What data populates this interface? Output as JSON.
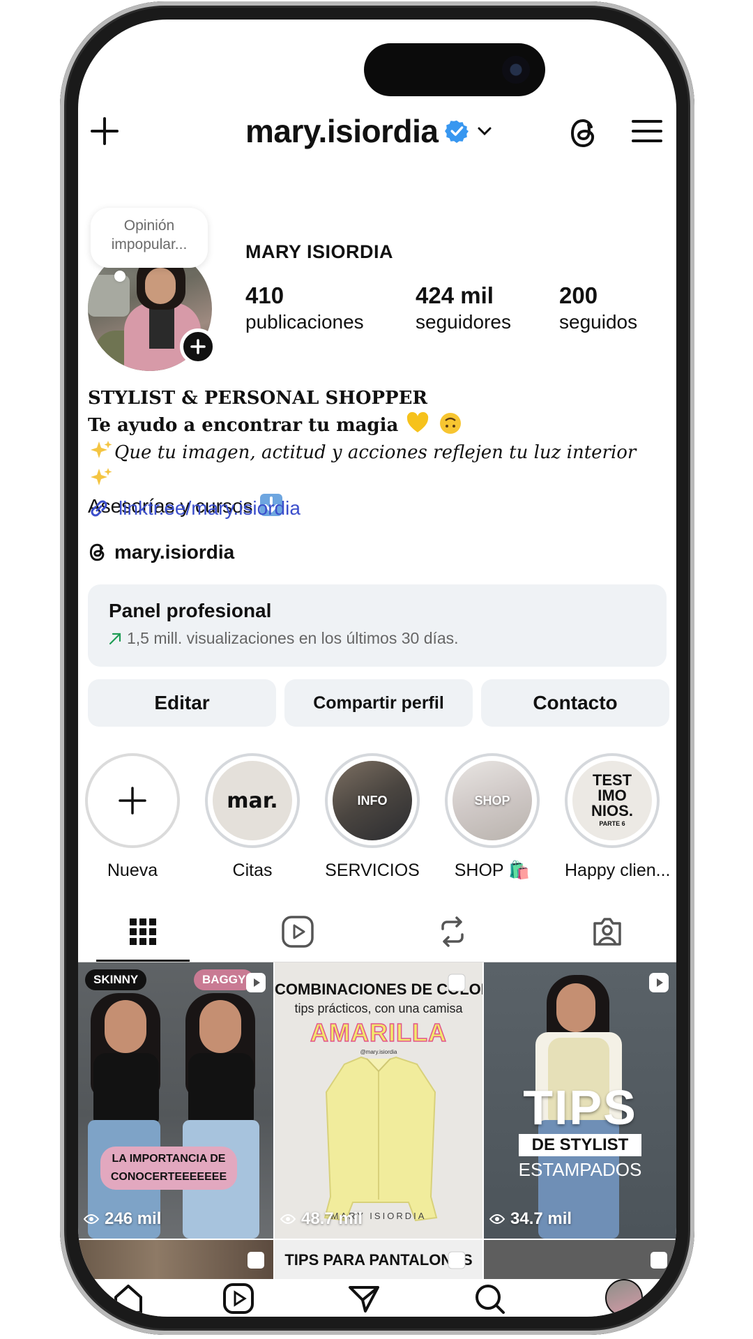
{
  "profile": {
    "username": "mary.isiordia",
    "full_name": "MARY ISIORDIA",
    "note": "Opinión impopular...",
    "stats": [
      {
        "num": "410",
        "label": "publicaciones"
      },
      {
        "num": "424 mil",
        "label": "seguidores"
      },
      {
        "num": "200",
        "label": "seguidos"
      }
    ],
    "bio": {
      "line1": "STYLIST & PERSONAL SHOPPER",
      "line2": "Te ayudo a encontrar tu magia",
      "line3": "Que tu imagen, actitud y acciones reflejen tu luz interior",
      "line4": "Asesorías y cursos"
    },
    "link": "linktr.ee/mary.isiordia",
    "threads_handle": "mary.isiordia"
  },
  "panel": {
    "title": "Panel profesional",
    "subtitle": "1,5 mill. visualizaciones en los últimos 30 días."
  },
  "buttons": {
    "edit": "Editar",
    "share": "Compartir perfil",
    "contact": "Contacto"
  },
  "highlights": [
    {
      "label": "Nueva",
      "inner": "+"
    },
    {
      "label": "Citas",
      "inner": "mar."
    },
    {
      "label": "SERVICIOS",
      "inner": "INFO"
    },
    {
      "label": "SHOP 🛍️",
      "inner": "SHOP"
    },
    {
      "label": "Happy clien...",
      "inner_lines": [
        "TEST",
        "IMO",
        "NIOS.",
        "PARTE 6"
      ]
    }
  ],
  "tabs": [
    "grid-icon",
    "reels-icon",
    "reposts-icon",
    "tagged-icon"
  ],
  "posts": [
    {
      "views": "246 mil",
      "tag_left": "SKINNY",
      "tag_right": "BAGGY",
      "banner_l1": "LA IMPORTANCIA DE",
      "banner_l2": "CONOCERTEEEEEEE"
    },
    {
      "views": "48.7 mil",
      "title": "COMBINACIONES DE COLOR",
      "subtitle": "tips prácticos, con una camisa",
      "headline": "AMARILLA",
      "watermark": "MARY ISIORDIA",
      "handle": "@mary.isiordia"
    },
    {
      "views": "34.7 mil",
      "big": "TIPS",
      "box": "DE STYLIST",
      "sub": "ESTAMPADOS"
    },
    {
      "title": ""
    },
    {
      "title": "TIPS PARA PANTALONES"
    },
    {
      "title": ""
    }
  ],
  "colors": {
    "verified": "#3897f0",
    "link": "#3b4ecb",
    "panel_bg": "#eff2f5",
    "trend_up": "#1f9d55"
  }
}
